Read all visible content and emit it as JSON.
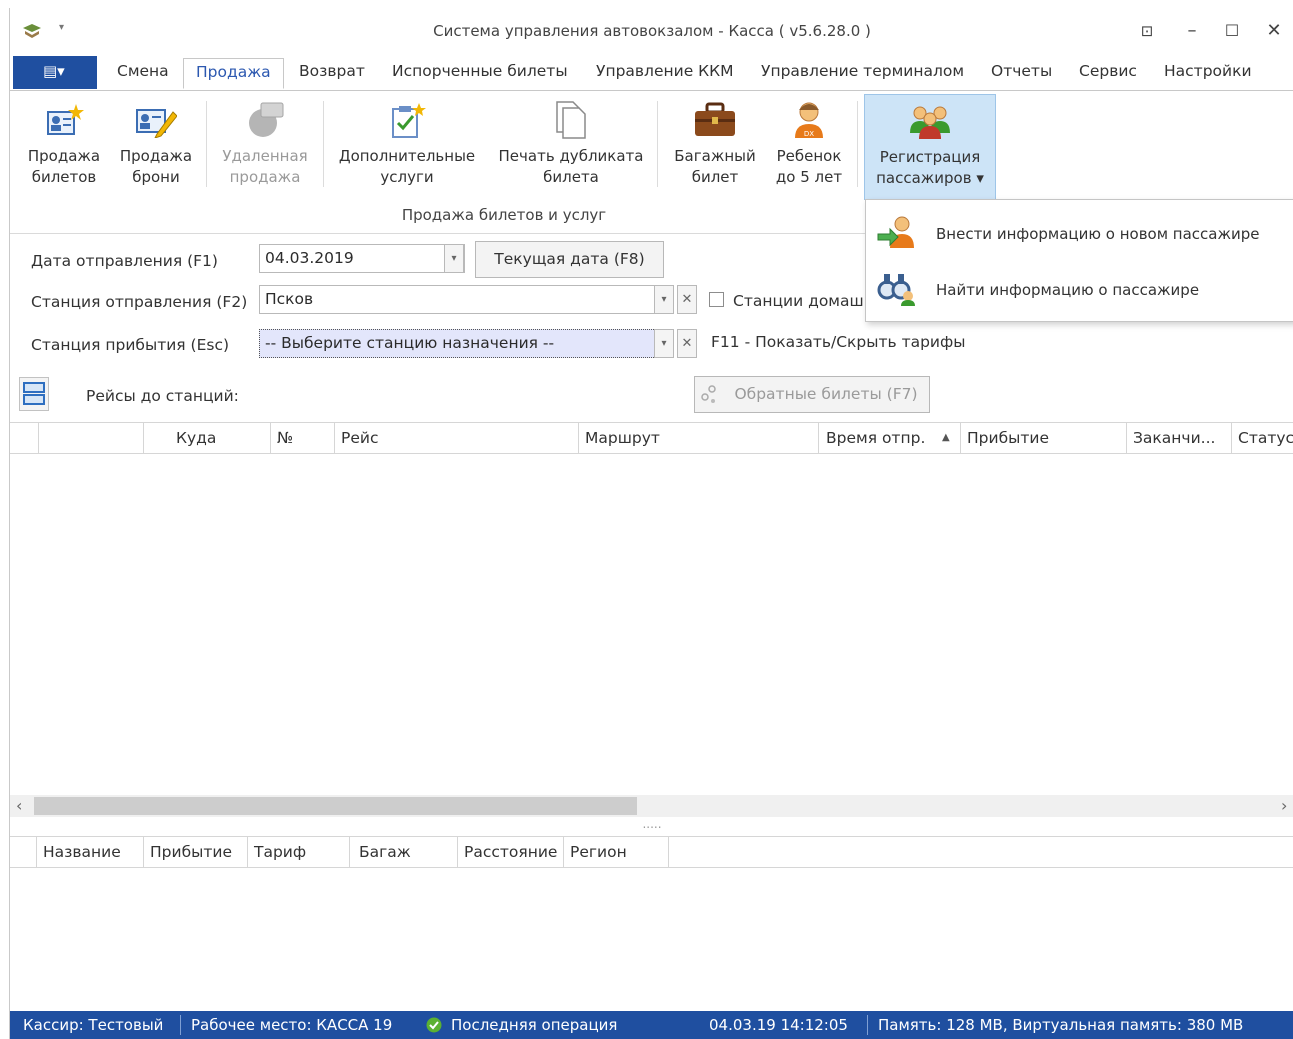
{
  "window": {
    "title": "Система управления автовокзалом - Касса ( v5.6.28.0 )",
    "qat_arrow": "▾",
    "controls": {
      "restore_icon": "⊡",
      "minimize": "–",
      "maximize": "☐",
      "close": "✕"
    }
  },
  "tabs": {
    "file_icon": "▤▾",
    "items": [
      {
        "label": "Смена"
      },
      {
        "label": "Продажа",
        "active": true
      },
      {
        "label": "Возврат"
      },
      {
        "label": "Испорченные билеты"
      },
      {
        "label": "Управление ККМ"
      },
      {
        "label": "Управление терминалом"
      },
      {
        "label": "Отчеты"
      },
      {
        "label": "Сервис"
      },
      {
        "label": "Настройки"
      }
    ]
  },
  "ribbon": {
    "group_caption": "Продажа билетов и услуг",
    "buttons": [
      {
        "line1": "Продажа",
        "line2": "билетов",
        "icon": "ticket-sale-icon"
      },
      {
        "line1": "Продажа",
        "line2": "брони",
        "icon": "booking-sale-icon"
      },
      {
        "line1": "Удаленная",
        "line2": "продажа",
        "icon": "remote-sale-icon",
        "disabled": true
      },
      {
        "line1": "Дополнительные",
        "line2": "услуги",
        "icon": "extra-services-icon"
      },
      {
        "line1": "Печать дубликата",
        "line2": "билета",
        "icon": "duplicate-print-icon"
      },
      {
        "line1": "Багажный",
        "line2": "билет",
        "icon": "luggage-icon"
      },
      {
        "line1": "Ребенок",
        "line2": "до 5 лет",
        "icon": "child-icon"
      },
      {
        "line1": "Регистрация",
        "line2": "пассажиров ▾",
        "icon": "passenger-registration-icon",
        "hot": true
      }
    ]
  },
  "dropdown": {
    "items": [
      {
        "label": "Внести информацию о новом пассажире",
        "icon": "add-passenger-icon"
      },
      {
        "label": "Найти информацию о пассажире",
        "icon": "find-passenger-icon"
      }
    ]
  },
  "form": {
    "departure_date_label": "Дата отправления (F1)",
    "departure_date_value": "04.03.2019",
    "current_date_button": "Текущая дата (F8)",
    "departure_station_label": "Станция отправления (F2)",
    "departure_station_value": "Псков",
    "home_stations_checkbox": "Станции домаш",
    "arrival_station_label": "Станция прибытия (Esc)",
    "arrival_station_value": "-- Выберите станцию назначения --",
    "tariffs_hint": "F11 - Показать/Скрыть тарифы",
    "routes_label": "Рейсы до станций:",
    "return_tickets_button": "Обратные билеты (F7)",
    "clear_symbol": "✕",
    "dropdown_symbol": "▾"
  },
  "trips_grid": {
    "columns": [
      "",
      "",
      "Куда",
      "№",
      "Рейс",
      "Маршрут",
      "Время отпр.",
      "▲",
      "Прибытие",
      "Заканчи...",
      "Статус"
    ]
  },
  "scroll": {
    "left": "‹",
    "right": "›",
    "splitter": "....."
  },
  "stations_grid": {
    "columns": [
      "Название",
      "Прибытие",
      "Тариф",
      "Багаж",
      "Расстояние",
      "Регион"
    ]
  },
  "statusbar": {
    "cashier": "Кассир: Тестовый",
    "workplace": "Рабочее место: КАССА 19",
    "last_operation": "Последняя операция",
    "datetime": "04.03.19 14:12:05",
    "memory": "Память: 128 MB, Виртуальная память: 380 MB"
  },
  "colors": {
    "accent": "#1f4fa0",
    "active_tab_text": "#2c58b0",
    "hot_button": "#cde4f7",
    "ok_green": "#5bb132"
  }
}
